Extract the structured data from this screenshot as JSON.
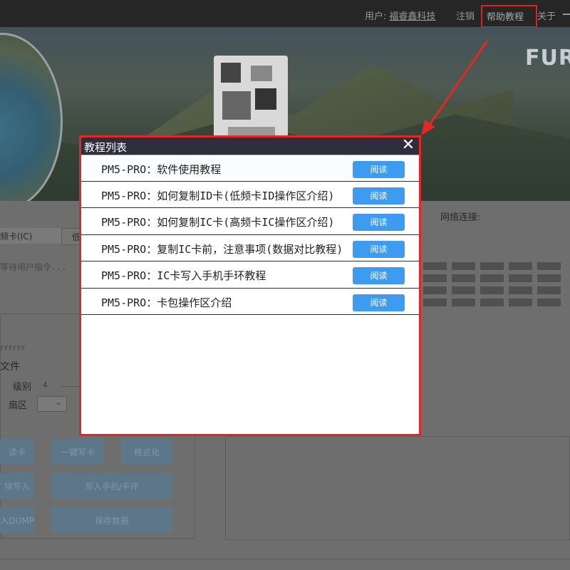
{
  "topbar": {
    "user_label": "用户:",
    "user_name": "福睿鑫科技",
    "logout": "注销",
    "help": "帮助教程",
    "about": "关于"
  },
  "banner": {
    "brand": "FUR"
  },
  "main": {
    "tab_ic": "频卡(IC)",
    "tab_2": "低",
    "wait_text": "等待用户指令...",
    "network_label": "网络连接:",
    "hex_text": "FFFFFF",
    "file_label": "文件",
    "level_label": "级别",
    "level_value": "4",
    "sector_label": "扇区",
    "buttons": {
      "read": "读卡",
      "onekey_write": "一键写卡",
      "format": "格式化",
      "block_write": "块写入",
      "write_phone": "写入手机/手环",
      "dump": "入DUMP",
      "save": "保存数据"
    }
  },
  "dialog": {
    "title": "教程列表",
    "close": "✕",
    "read_label": "阅读",
    "items": [
      {
        "title": "PM5-PRO：软件使用教程"
      },
      {
        "title": "PM5-PRO：如何复制ID卡(低频卡ID操作区介绍)"
      },
      {
        "title": "PM5-PRO：如何复制IC卡(高频卡IC操作区介绍)"
      },
      {
        "title": "PM5-PRO：复制IC卡前，注意事项(数据对比教程)"
      },
      {
        "title": "PM5-PRO：IC卡写入手机手环教程"
      },
      {
        "title": "PM5-PRO：卡包操作区介绍"
      }
    ]
  },
  "colors": {
    "accent_red": "#e02828",
    "read_button": "#3d9cf0",
    "titlebar": "#2e2e3c"
  }
}
